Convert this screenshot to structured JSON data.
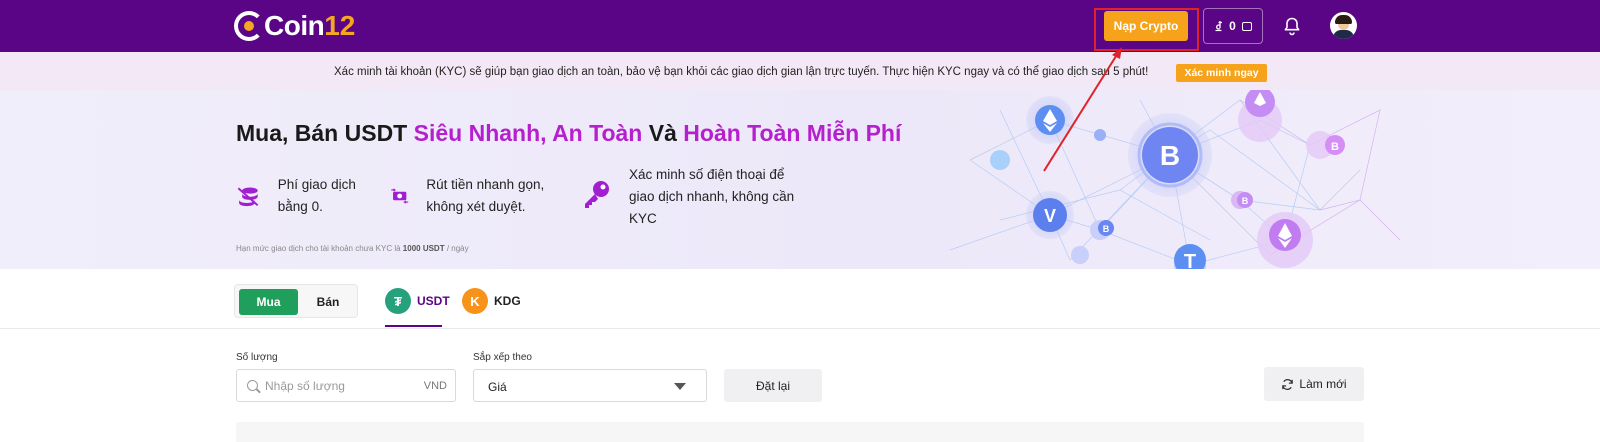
{
  "header": {
    "logo_text": "Coin",
    "logo_number": "12",
    "deposit_label": "Nạp Crypto",
    "wallet_balance": "0"
  },
  "kyc_banner": {
    "message": "Xác minh tài khoản (KYC) sẽ giúp bạn giao dịch an toàn, bảo vệ bạn khỏi các giao dịch gian lận trực tuyến. Thực hiện KYC ngay và có thể giao dịch sau 5 phút!",
    "button_label": "Xác minh ngay"
  },
  "hero": {
    "title_part1": "Mua, Bán USDT ",
    "title_highlight1": "Siêu Nhanh, An Toàn",
    "title_part2": " Và ",
    "title_highlight2": "Hoàn Toàn Miễn Phí",
    "features": [
      {
        "icon": "coins-stack-icon",
        "text": "Phí giao dịch bằng 0."
      },
      {
        "icon": "cash-transfer-icon",
        "text": "Rút tiền nhanh gọn, không xét duyệt."
      },
      {
        "icon": "key-icon",
        "text": "Xác minh số điện thoại để giao dịch nhanh, không cần KYC"
      }
    ],
    "note_prefix": "Hạn mức giao dịch cho tài khoản chưa KYC là ",
    "note_amount": "1000 USDT",
    "note_suffix": " / ngày"
  },
  "trade_tabs": {
    "buy_label": "Mua",
    "sell_label": "Bán"
  },
  "coin_tabs": [
    {
      "label": "USDT",
      "icon": "tether-icon",
      "color": "#26a17b"
    },
    {
      "label": "KDG",
      "icon": "kdg-icon",
      "color": "#f7931a"
    }
  ],
  "filters": {
    "amount_label": "Số lượng",
    "amount_placeholder": "Nhập số lượng",
    "amount_unit": "VND",
    "sort_label": "Sắp xếp theo",
    "sort_value": "Giá",
    "reset_label": "Đặt lại",
    "refresh_label": "Làm mới"
  },
  "colors": {
    "topbar": "#5a0585",
    "accent_orange": "#f7a21b",
    "highlight_purple": "#b51fce",
    "buy_green": "#1f9e5c"
  }
}
